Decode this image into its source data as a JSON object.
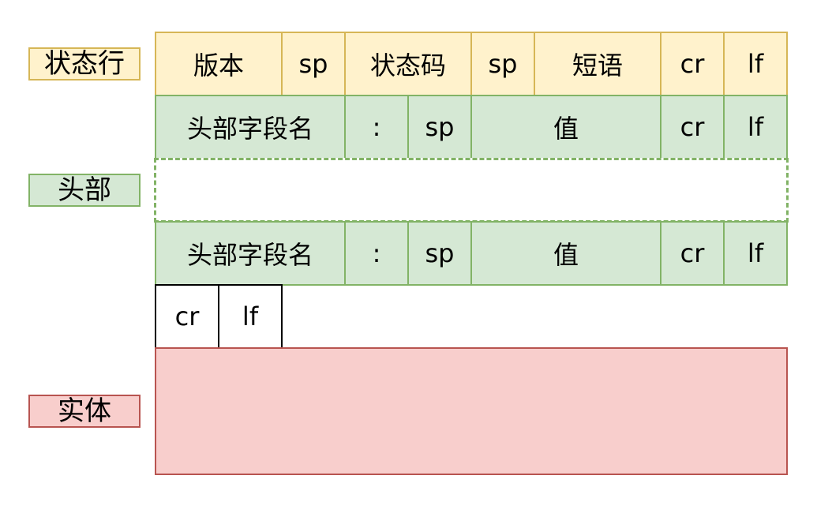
{
  "labels": {
    "status_line": "状态行",
    "headers": "头部",
    "body": "实体"
  },
  "status_line": {
    "version": "版本",
    "sp1": "sp",
    "status_code": "状态码",
    "sp2": "sp",
    "phrase": "短语",
    "cr": "cr",
    "lf": "lf"
  },
  "header_row_1": {
    "field_name": "头部字段名",
    "colon": ":",
    "sp": "sp",
    "value": "值",
    "cr": "cr",
    "lf": "lf"
  },
  "header_row_2": {
    "field_name": "头部字段名",
    "colon": ":",
    "sp": "sp",
    "value": "值",
    "cr": "cr",
    "lf": "lf"
  },
  "blank_line": {
    "cr": "cr",
    "lf": "lf"
  },
  "colors": {
    "status_fill": "#fff2cc",
    "status_stroke": "#d6b656",
    "header_fill": "#d5e8d4",
    "header_stroke": "#82b366",
    "body_fill": "#f8cecc",
    "body_stroke": "#b85450"
  }
}
